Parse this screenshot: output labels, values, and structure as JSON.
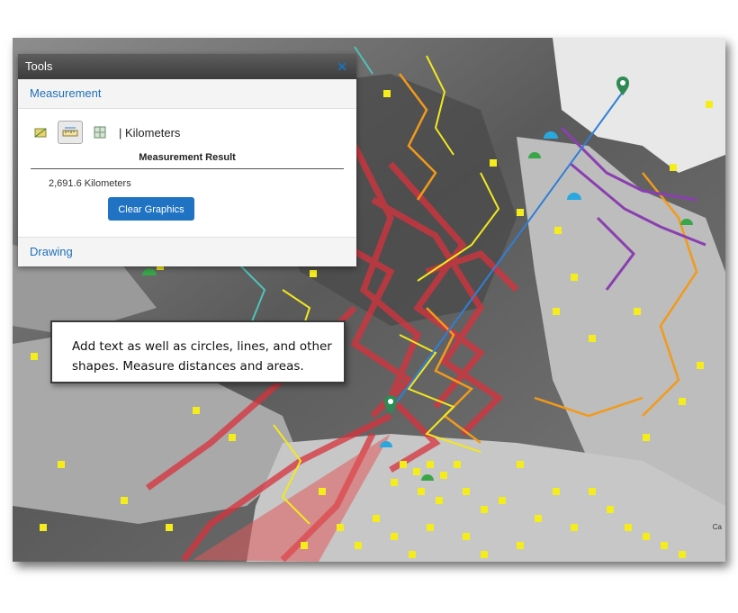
{
  "tools_panel": {
    "title": "Tools",
    "close_icon": "close-icon",
    "measurement": {
      "section_title": "Measurement",
      "unit_label": "| Kilometers",
      "tool_icons": [
        "area-measure-icon",
        "distance-measure-icon",
        "location-measure-icon"
      ],
      "result_header": "Measurement Result",
      "result_value": "2,691.6 Kilometers",
      "clear_button_label": "Clear Graphics"
    },
    "drawing": {
      "section_title": "Drawing"
    }
  },
  "callout": {
    "line1": "Add text as well as circles, lines, and other",
    "line2": "shapes.  Measure distances and areas."
  },
  "map": {
    "attribution": "Ca",
    "colors": {
      "track_red": "#d8323c",
      "track_orange": "#f29a1a",
      "track_yellow": "#f2e81e",
      "track_purple": "#8a3fb0",
      "track_teal": "#4fc3b8",
      "station_yellow": "#f5ec1c",
      "measure_line": "#2f7fd6",
      "marker_green": "#2e8a54"
    }
  }
}
